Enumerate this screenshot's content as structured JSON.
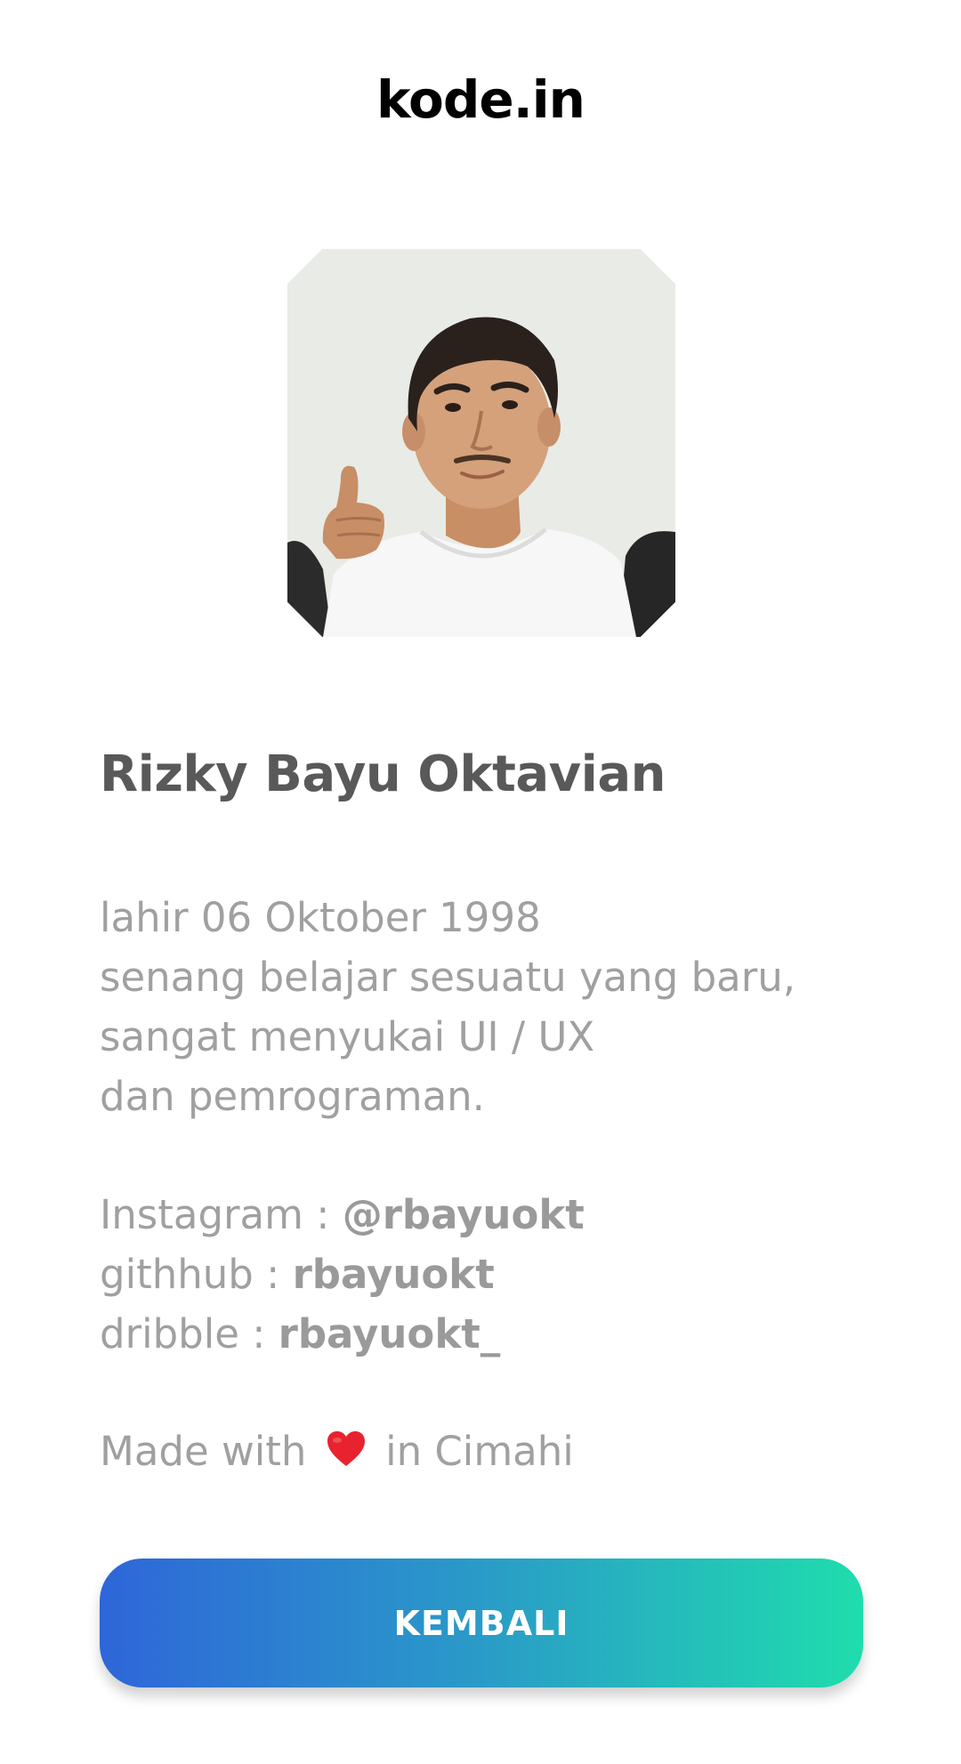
{
  "header": {
    "title": "kode.in"
  },
  "profile": {
    "photo_icon": "profile-photo",
    "name": "Rizky Bayu Oktavian",
    "bio_lines": [
      "lahir 06 Oktober 1998",
      "senang belajar sesuatu yang baru,",
      "sangat menyukai UI / UX",
      "dan pemrograman."
    ],
    "socials": [
      {
        "label": "Instagram : ",
        "handle": "@rbayuokt"
      },
      {
        "label": "githhub : ",
        "handle": "rbayuokt"
      },
      {
        "label": "dribble : ",
        "handle": "rbayuokt_"
      }
    ],
    "made_with_prefix": "Made with",
    "made_with_suffix": "in Cimahi",
    "heart_icon": "heart-icon"
  },
  "actions": {
    "back_label": "KEMBALI"
  },
  "colors": {
    "title": "#000000",
    "name": "#595959",
    "body_text": "#a0a0a0",
    "button_gradient_start": "#2e66d9",
    "button_gradient_end": "#1fddad",
    "heart": "#e8232f"
  }
}
